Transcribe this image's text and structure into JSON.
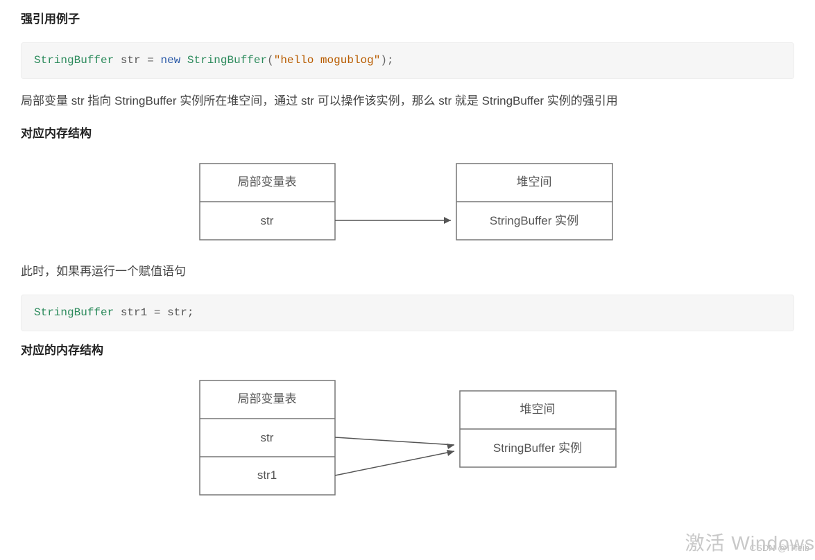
{
  "headings": {
    "h1": "强引用例子",
    "h2": "对应内存结构",
    "h3": "对应的内存结构"
  },
  "code": {
    "block1": {
      "type1": "StringBuffer",
      "var": "str",
      "eq": "=",
      "kw": "new",
      "type2": "StringBuffer",
      "lp": "(",
      "str": "\"hello mogublog\"",
      "rp": ");"
    },
    "block2": {
      "type1": "StringBuffer",
      "var": "str1",
      "eq": "=",
      "rhs": "str;"
    }
  },
  "paragraphs": {
    "p1": "局部变量 str 指向 StringBuffer 实例所在堆空间，通过 str 可以操作该实例，那么 str 就是 StringBuffer 实例的强引用",
    "p2": "此时，如果再运行一个赋值语句"
  },
  "diagrams": {
    "d1": {
      "leftHeader": "局部变量表",
      "leftCell": "str",
      "rightHeader": "堆空间",
      "rightCell": "StringBuffer 实例"
    },
    "d2": {
      "leftHeader": "局部变量表",
      "leftCell1": "str",
      "leftCell2": "str1",
      "rightHeader": "堆空间",
      "rightCell": "StringBuffer 实例"
    }
  },
  "watermark": {
    "csdn": "CSDN @ITfeib",
    "activate": "激活 Windows"
  }
}
